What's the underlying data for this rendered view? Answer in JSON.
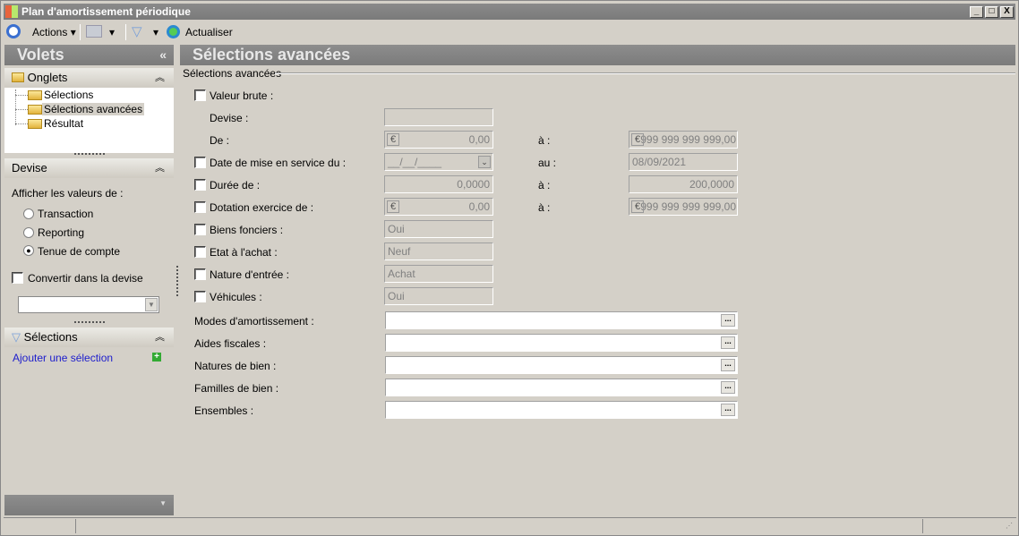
{
  "window": {
    "title": "Plan d'amortissement périodique",
    "minimize": "_",
    "maximize": "□",
    "close": "X"
  },
  "toolbar": {
    "actions": "Actions",
    "refresh": "Actualiser"
  },
  "left": {
    "title": "Volets",
    "collapse": "«",
    "onglets": {
      "title": "Onglets",
      "items": [
        "Sélections",
        "Sélections avancées",
        "Résultat"
      ],
      "selected": 1
    },
    "devise": {
      "title": "Devise",
      "prompt": "Afficher les valeurs de :",
      "options": [
        "Transaction",
        "Reporting",
        "Tenue de compte"
      ],
      "selected": 2,
      "convert_label": "Convertir dans la devise",
      "convert_checked": false,
      "currency_value": ""
    },
    "selections": {
      "title": "Sélections",
      "add_link": "Ajouter une sélection"
    }
  },
  "main": {
    "title": "Sélections avancées",
    "group": "Sélections avancées",
    "valeur_brute": {
      "label": "Valeur brute :",
      "devise_label": "Devise :",
      "devise_value": "",
      "de_label": "De :",
      "de_value": "0,00",
      "a_label": "à :",
      "a_value": "999 999 999 999,00"
    },
    "date": {
      "label": "Date de mise en service du :",
      "from": "__/__/____",
      "to_label": "au :",
      "to": "08/09/2021"
    },
    "duree": {
      "label": "Durée de :",
      "from": "0,0000",
      "to_label": "à :",
      "to": "200,0000"
    },
    "dotation": {
      "label": "Dotation exercice de :",
      "from": "0,00",
      "to_label": "à :",
      "to": "999 999 999 999,00"
    },
    "biens_fonciers": {
      "label": "Biens fonciers :",
      "value": "Oui"
    },
    "etat": {
      "label": "Etat à l'achat :",
      "value": "Neuf"
    },
    "nature_entree": {
      "label": "Nature d'entrée :",
      "value": "Achat"
    },
    "vehicules": {
      "label": "Véhicules :",
      "value": "Oui"
    },
    "lookups": [
      {
        "label": "Modes d'amortissement :",
        "value": ""
      },
      {
        "label": "Aides fiscales :",
        "value": ""
      },
      {
        "label": "Natures de bien :",
        "value": ""
      },
      {
        "label": "Familles de bien :",
        "value": ""
      },
      {
        "label": "Ensembles :",
        "value": ""
      }
    ],
    "lookup_button": "..."
  }
}
